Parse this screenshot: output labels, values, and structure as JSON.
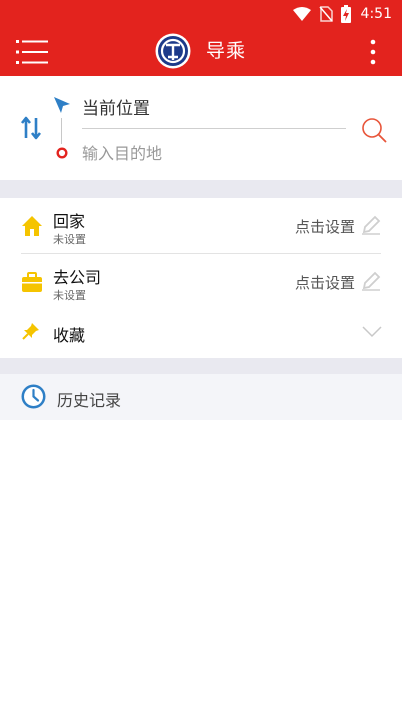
{
  "status_bar": {
    "time": "4:51"
  },
  "app_bar": {
    "title": "导乘"
  },
  "route": {
    "origin": "当前位置",
    "destination_placeholder": "输入目的地",
    "destination_value": ""
  },
  "places": [
    {
      "name": "回家",
      "status": "未设置",
      "action": "点击设置"
    },
    {
      "name": "去公司",
      "status": "未设置",
      "action": "点击设置"
    }
  ],
  "favorites": {
    "label": "收藏"
  },
  "history": {
    "label": "历史记录"
  },
  "colors": {
    "brand_red": "#e3231e",
    "accent_blue": "#2e7fc6",
    "home_yellow": "#f5c400",
    "divider_gray": "#e9e9f0"
  },
  "icons": {
    "menu": "menu-icon",
    "logo": "railway-logo",
    "more": "more-vertical-icon",
    "swap": "swap-icon",
    "location": "location-arrow-icon",
    "destination": "destination-dot-icon",
    "search": "search-icon",
    "home": "home-icon",
    "company": "briefcase-icon",
    "edit": "pencil-icon",
    "favorite": "pin-icon",
    "expand": "chevron-down-icon",
    "history": "clock-icon"
  }
}
